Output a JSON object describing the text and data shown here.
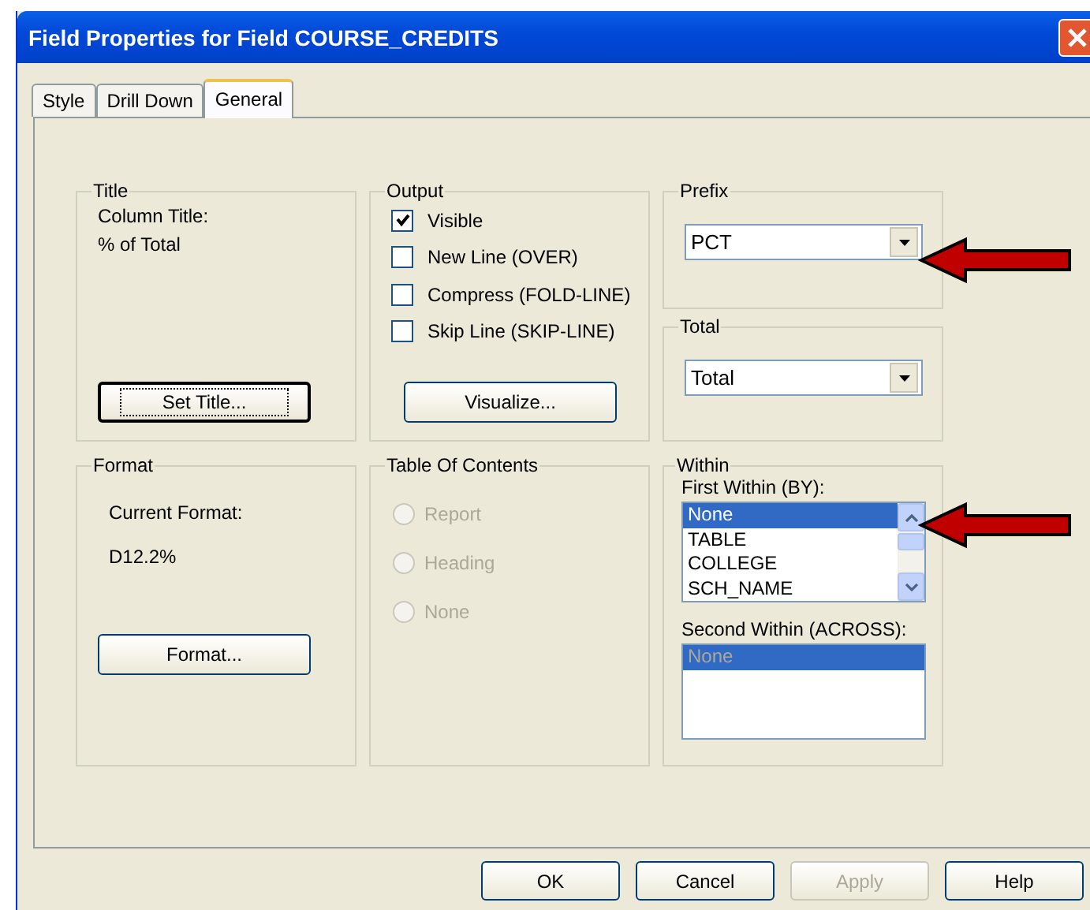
{
  "window": {
    "title": "Field Properties for Field COURSE_CREDITS"
  },
  "tabs": [
    {
      "label": "Style",
      "selected": false
    },
    {
      "label": "Drill Down",
      "selected": false
    },
    {
      "label": "General",
      "selected": true
    }
  ],
  "title_group": {
    "label": "Title",
    "lines": [
      "Column Title:",
      "% of Total"
    ],
    "button": "Set Title..."
  },
  "output_group": {
    "label": "Output",
    "options": [
      {
        "label": "Visible",
        "checked": true
      },
      {
        "label": "New Line (OVER)",
        "checked": false
      },
      {
        "label": "Compress (FOLD-LINE)",
        "checked": false
      },
      {
        "label": "Skip Line (SKIP-LINE)",
        "checked": false
      }
    ],
    "button": "Visualize..."
  },
  "prefix_group": {
    "label": "Prefix",
    "value": "PCT"
  },
  "total_group": {
    "label": "Total",
    "value": "Total"
  },
  "format_group": {
    "label": "Format",
    "lines": [
      "Current Format:",
      "D12.2%"
    ],
    "button": "Format..."
  },
  "toc_group": {
    "label": "Table Of Contents",
    "options": [
      {
        "label": "Report",
        "selected": false,
        "disabled": true
      },
      {
        "label": "Heading",
        "selected": false,
        "disabled": true
      },
      {
        "label": "None",
        "selected": false,
        "disabled": true
      }
    ]
  },
  "within_group": {
    "label": "Within",
    "lists": [
      {
        "label": "First Within (BY):",
        "disabled": false,
        "scrollbar": true,
        "items": [
          {
            "label": "None",
            "selected": true
          },
          {
            "label": "TABLE",
            "selected": false
          },
          {
            "label": "COLLEGE",
            "selected": false
          },
          {
            "label": "SCH_NAME",
            "selected": false
          }
        ]
      },
      {
        "label": "Second Within (ACROSS):",
        "disabled": true,
        "scrollbar": false,
        "items": [
          {
            "label": "None",
            "selected": true
          }
        ]
      }
    ]
  },
  "buttons": [
    {
      "label": "OK",
      "disabled": false
    },
    {
      "label": "Cancel",
      "disabled": false
    },
    {
      "label": "Apply",
      "disabled": true
    },
    {
      "label": "Help",
      "disabled": false
    }
  ]
}
